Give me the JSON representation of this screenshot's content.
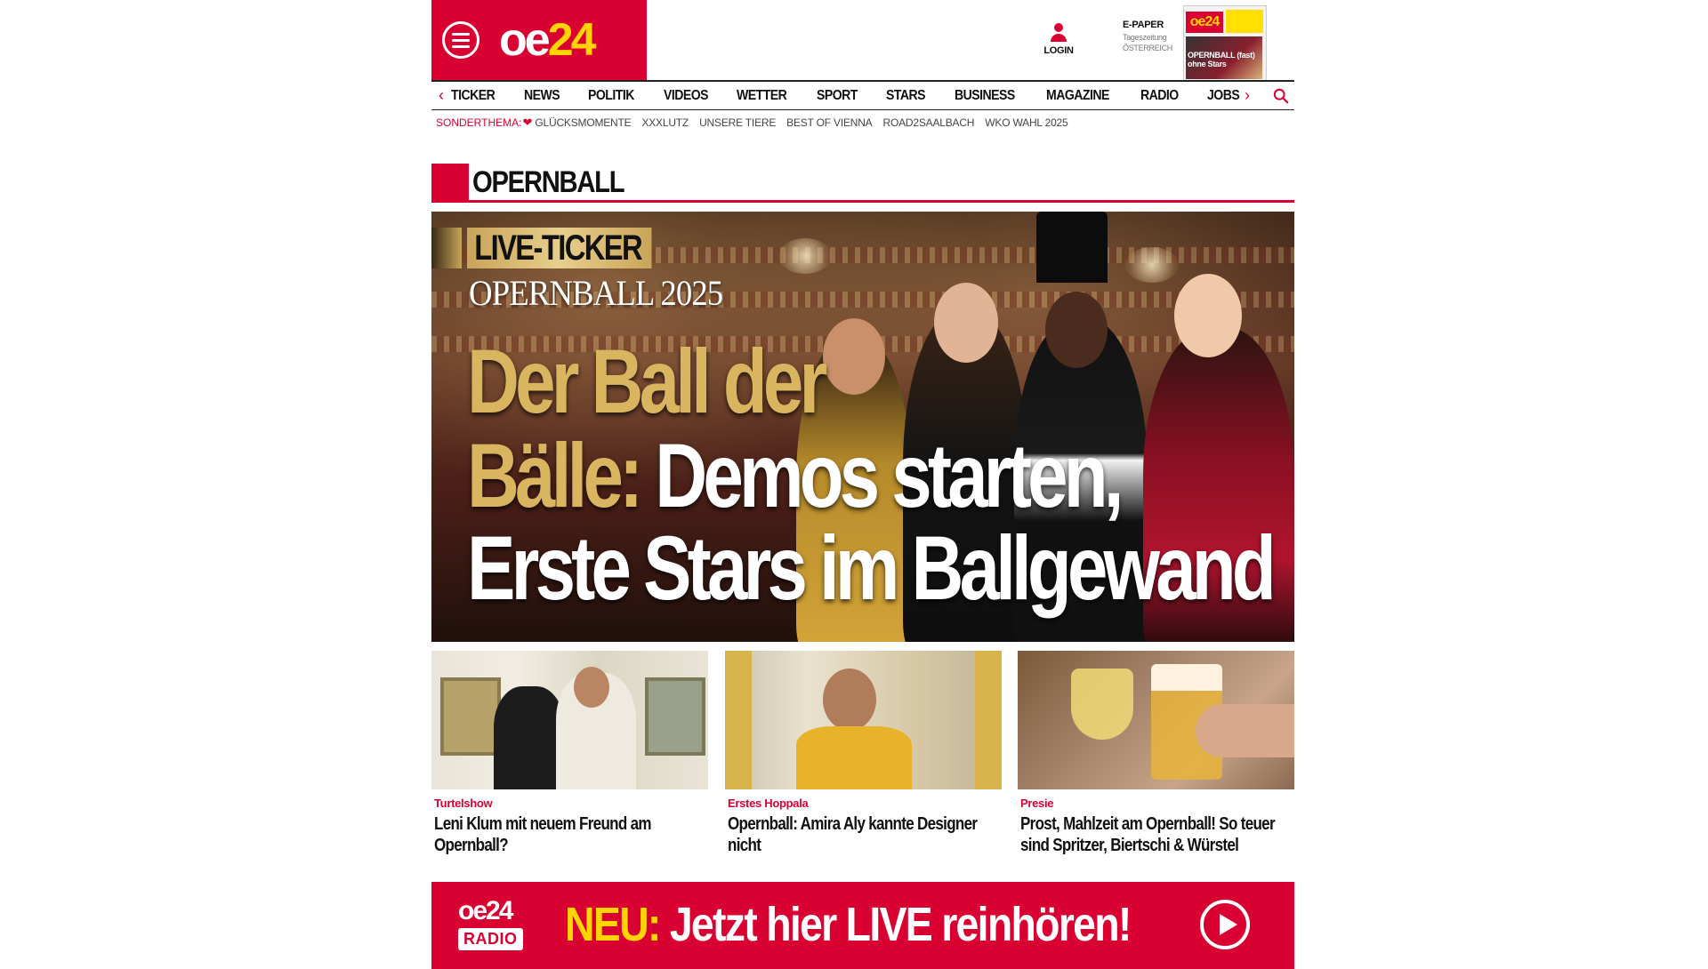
{
  "brand": {
    "logo_text_a": "oe",
    "logo_text_b": "24",
    "primary_color": "#d90032",
    "accent_color": "#ffd400"
  },
  "header": {
    "login_label": "LOGIN",
    "epaper_title": "E-PAPER",
    "epaper_sub1": "Tageszeitung",
    "epaper_sub2": "ÖSTERREICH",
    "epaper_cover_logo": "oe24",
    "epaper_cover_headline": "OPERNBALL (fast) ohne Stars"
  },
  "nav": {
    "items": [
      {
        "label": "TICKER"
      },
      {
        "label": "NEWS"
      },
      {
        "label": "POLITIK"
      },
      {
        "label": "VIDEOS"
      },
      {
        "label": "WETTER"
      },
      {
        "label": "SPORT"
      },
      {
        "label": "STARS"
      },
      {
        "label": "BUSINESS"
      },
      {
        "label": "MAGAZINE"
      },
      {
        "label": "RADIO"
      },
      {
        "label": "JOBS"
      }
    ],
    "prev_icon": "chevron-left-icon",
    "next_icon": "chevron-right-icon",
    "search_icon": "search-icon"
  },
  "subnav": {
    "label": "SONDERTHEMA:",
    "items": [
      {
        "label": "GLÜCKSMOMENTE"
      },
      {
        "label": "XXXLUTZ"
      },
      {
        "label": "UNSERE TIERE"
      },
      {
        "label": "BEST OF VIENNA"
      },
      {
        "label": "ROAD2SAALBACH"
      },
      {
        "label": "WKO WAHL 2025"
      }
    ]
  },
  "section": {
    "title": "OPERNBALL"
  },
  "hero": {
    "badge": "LIVE-TICKER",
    "subtitle": "OPERNBALL 2025",
    "line1": "Der Ball der",
    "line2_gold": "Bälle:",
    "line2_white": " Demos starten,",
    "line3": "Erste Stars im Ballgewand"
  },
  "teasers": [
    {
      "kicker": "Turtelshow",
      "headline": "Leni Klum mit neuem Freund am Opernball?"
    },
    {
      "kicker": "Erstes Hoppala",
      "headline": "Opernball: Amira Aly kannte Designer nicht"
    },
    {
      "kicker": "Presie",
      "headline": "Prost, Mahlzeit am Opernball! So teuer sind Spritzer, Biertschi & Würstel"
    }
  ],
  "radio_banner": {
    "logo": "oe24",
    "logo_sub": "RADIO",
    "highlight": "NEU:",
    "text": " Jetzt hier LIVE reinhören!",
    "play_icon": "play-icon"
  }
}
